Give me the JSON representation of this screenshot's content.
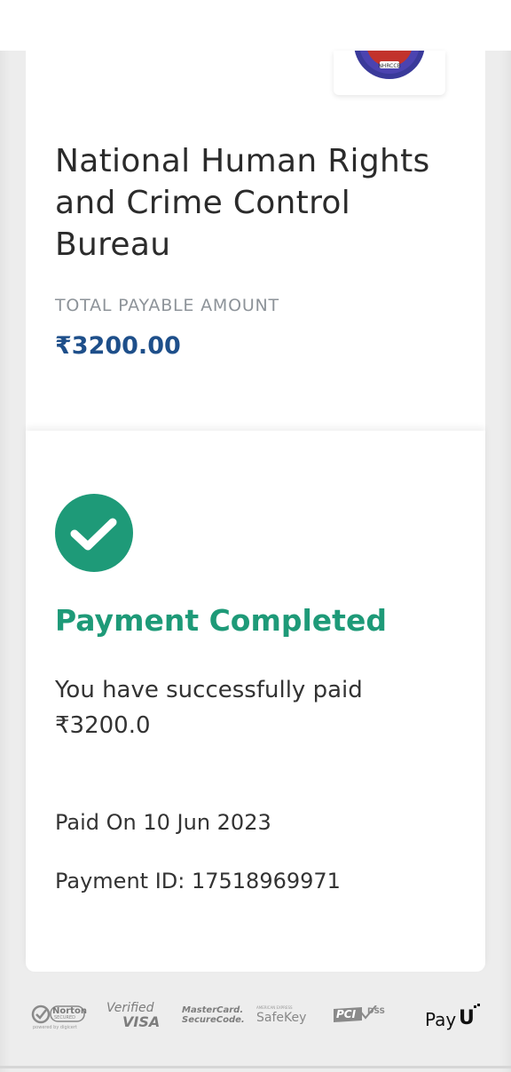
{
  "merchant": {
    "name": "National Human Rights and Crime Control Bureau",
    "logo_text": "NHRCCB"
  },
  "amount": {
    "label": "TOTAL PAYABLE AMOUNT",
    "value": "₹3200.00"
  },
  "status": {
    "title": "Payment Completed",
    "message": "You have successfully paid ₹3200.0",
    "paid_on": "Paid On 10 Jun 2023",
    "payment_id": "Payment ID: 17518969971",
    "color": "#1e9a78"
  },
  "footer": {
    "norton_title": "Norton",
    "norton_sub": "SECURED",
    "norton_caption": "powered by digicert",
    "verified_visa_top": "Verified",
    "verified_visa_bottom": "VISA",
    "mastercard_top": "MasterCard.",
    "mastercard_bottom": "SecureCode.",
    "safekey_top": "AMERICAN EXPRESS",
    "safekey": "SafeKey",
    "pci": "PCI",
    "dss": "DSS",
    "payu_pay": "Pay",
    "payu_u": "U"
  }
}
